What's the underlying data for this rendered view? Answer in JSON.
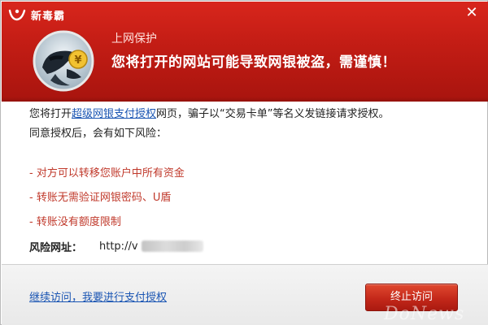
{
  "window": {
    "brand": "新毒霸",
    "close_glyph": "✕",
    "icon": "kingsoft-logo-icon"
  },
  "header": {
    "subtitle": "上网保护",
    "title": "您将打开的网站可能导致网银被盗，需谨慎！",
    "badge_icon": "thief-with-coin-icon",
    "color": "#c41d15"
  },
  "body": {
    "intro_before": "您将打开",
    "intro_link": "超级网银支付授权",
    "intro_after": "网页，骗子以“交易卡单”等名义发链接请求授权。",
    "intro_line2": "同意授权后，会有如下风险：",
    "risks": [
      "- 对方可以转移您账户中所有资金",
      "- 转账无需验证网银密码、U盾",
      "- 转账没有额度限制"
    ],
    "risk_color": "#c0392b",
    "url_label": "风险网址：",
    "url_value": "http://v"
  },
  "footer": {
    "continue_link": "继续访问，我要进行支付授权",
    "stop_button": "终止访问",
    "watermark": "DoNews"
  }
}
